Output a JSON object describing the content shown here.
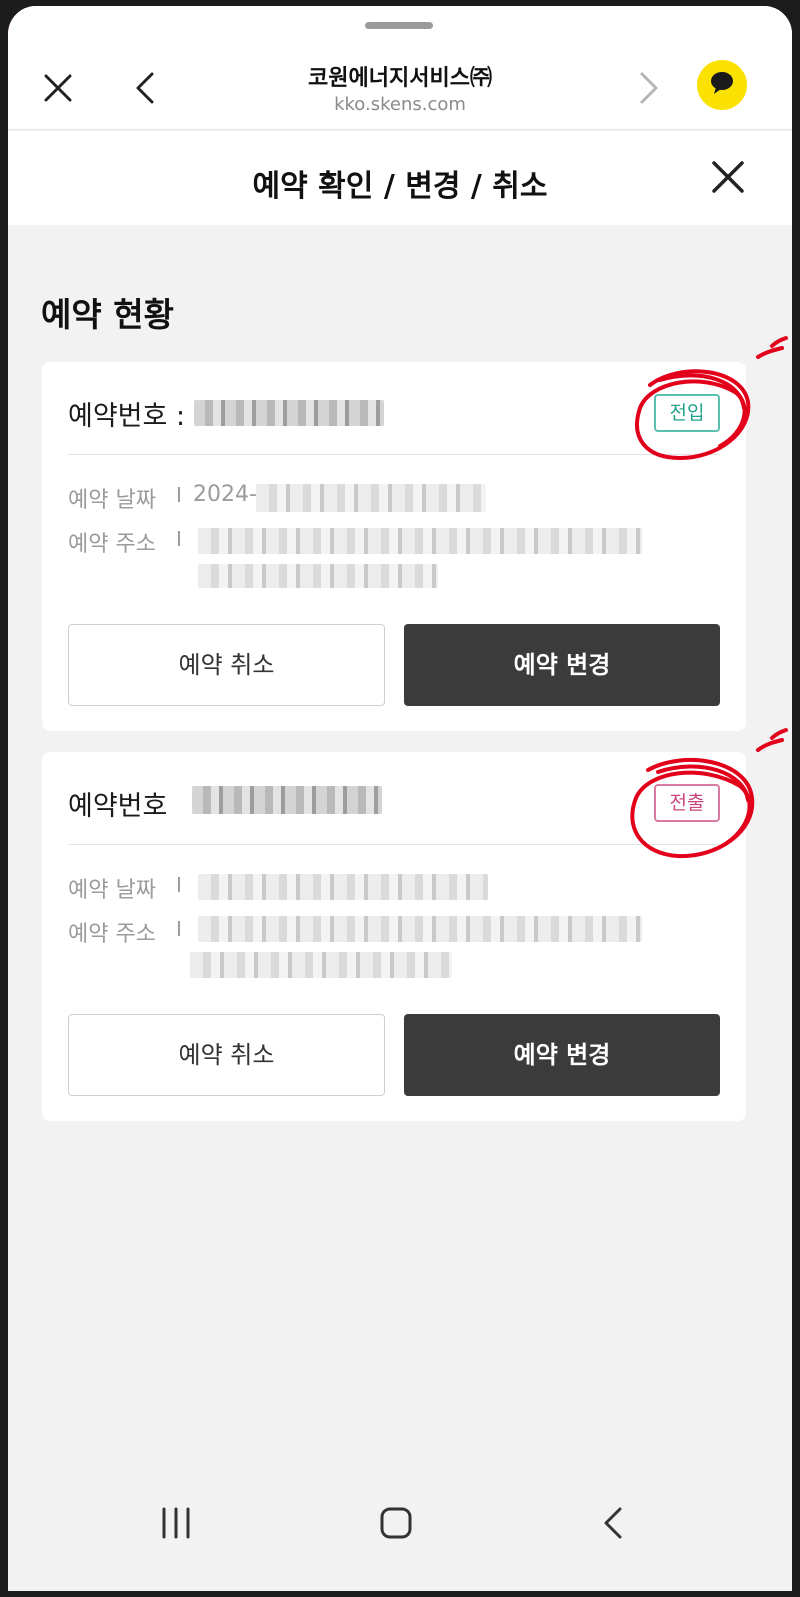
{
  "browser": {
    "title": "코원에너지서비스㈜",
    "url": "kko.skens.com",
    "icons": {
      "close": "close-icon",
      "back": "chevron-left-icon",
      "forward": "chevron-right-icon",
      "kakao": "kakaotalk-icon"
    }
  },
  "page": {
    "title": "예약 확인 / 변경 / 취소",
    "section_title": "예약 현황"
  },
  "reservations": [
    {
      "number_label": "예약번호 :",
      "tag": "전입",
      "tag_color": "#23a28c",
      "date_label": "예약 날짜",
      "date_value": "2024-",
      "address_label": "예약 주소",
      "separator": "I",
      "cancel_label": "예약 취소",
      "change_label": "예약 변경"
    },
    {
      "number_label": "예약번호",
      "tag": "전출",
      "tag_color": "#c8457d",
      "date_label": "예약 날짜",
      "date_value": "",
      "address_label": "예약 주소",
      "separator": "I",
      "cancel_label": "예약 취소",
      "change_label": "예약 변경"
    }
  ],
  "colors": {
    "accent_dark": "#3b3b3b",
    "kakao_yellow": "#fae100",
    "annotation_red": "#e3001b"
  },
  "nav": {
    "icons": [
      "recent-apps-icon",
      "home-icon",
      "back-icon"
    ]
  }
}
